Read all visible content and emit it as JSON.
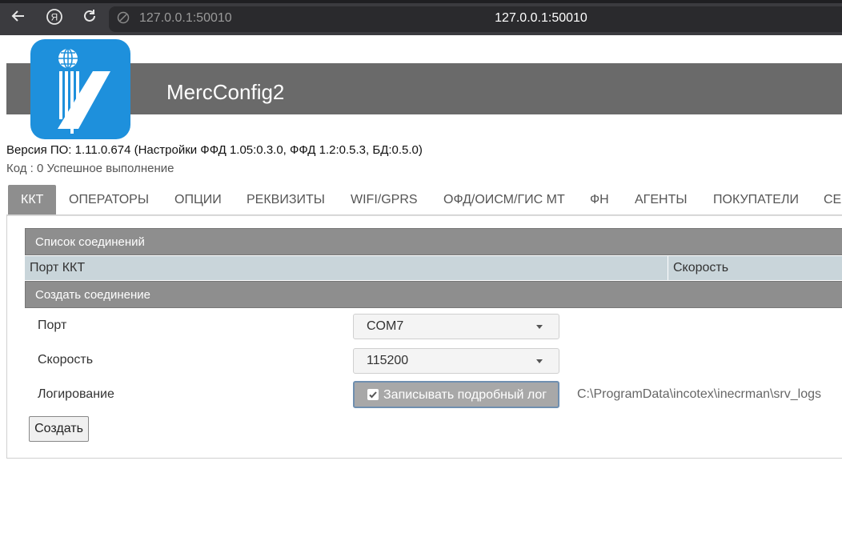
{
  "browser": {
    "back_icon": "arrow-left-icon",
    "home_icon": "yandex-icon",
    "reload_icon": "reload-icon",
    "url": "127.0.0.1:50010",
    "tab_title": "127.0.0.1:50010"
  },
  "app": {
    "title": "MercConfig2",
    "version": "Версия ПО: 1.11.0.674 (Настройки ФФД 1.05:0.3.0, ФФД 1.2:0.5.3, БД:0.5.0)",
    "status": "Код : 0 Успешное выполнение",
    "header_color": "#6a6a6a",
    "logo_color": "#1e90dc"
  },
  "tabs": [
    {
      "label": "ККТ",
      "active": true
    },
    {
      "label": "ОПЕРАТОРЫ"
    },
    {
      "label": "ОПЦИИ"
    },
    {
      "label": "РЕКВИЗИТЫ"
    },
    {
      "label": "WIFI/GPRS"
    },
    {
      "label": "ОФД/ОИСМ/ГИС МТ"
    },
    {
      "label": "ФН"
    },
    {
      "label": "АГЕНТЫ"
    },
    {
      "label": "ПОКУПАТЕЛИ"
    },
    {
      "label": "СЕ"
    }
  ],
  "connections": {
    "title": "Список соединений",
    "columns": [
      "Порт ККТ",
      "Скорость"
    ]
  },
  "create": {
    "title": "Создать соединение",
    "port_label": "Порт",
    "port_value": "COM7",
    "speed_label": "Скорость",
    "speed_value": "115200",
    "logging_label": "Логирование",
    "logging_checkbox": "Записывать подробный лог",
    "logging_checked": true,
    "log_path": "C:\\ProgramData\\incotex\\inecrman\\srv_logs",
    "create_button": "Создать"
  }
}
